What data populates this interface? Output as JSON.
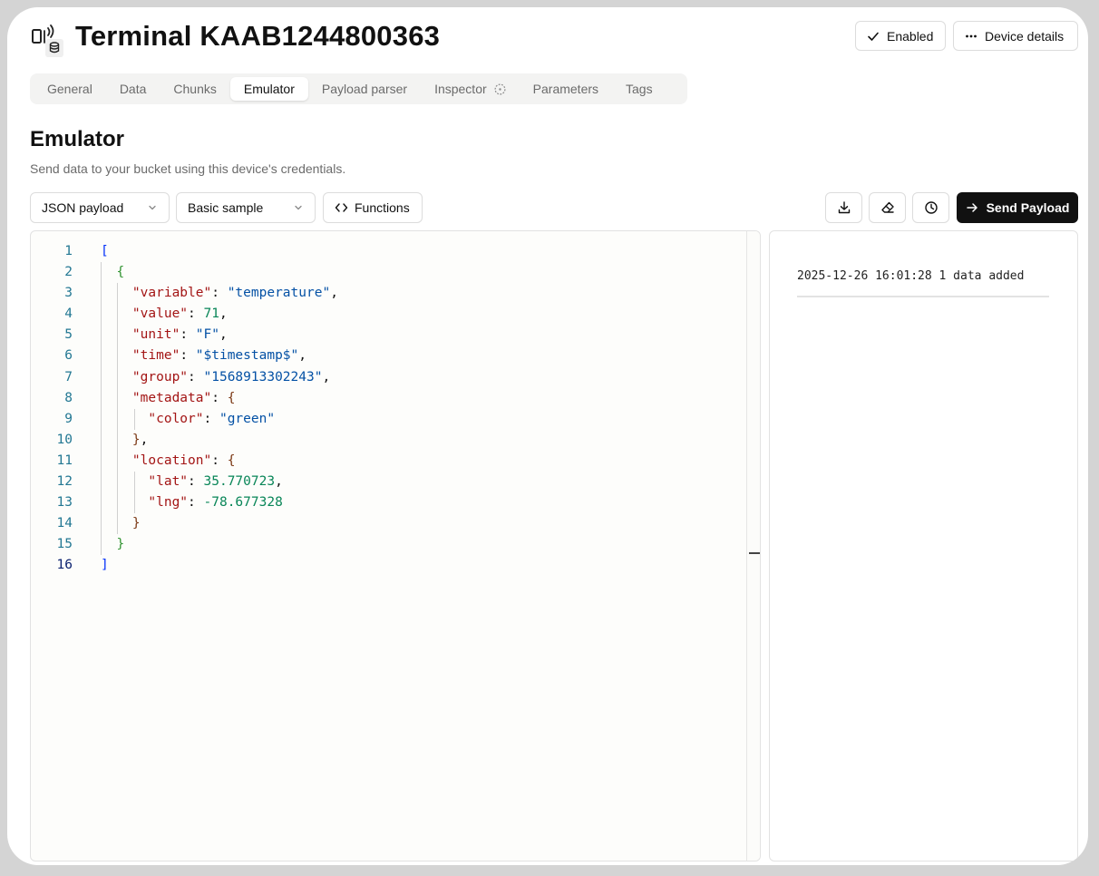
{
  "header": {
    "title": "Terminal KAAB1244800363",
    "enabled_label": "Enabled",
    "details_label": "Device details"
  },
  "tabs": [
    {
      "label": "General"
    },
    {
      "label": "Data"
    },
    {
      "label": "Chunks"
    },
    {
      "label": "Emulator",
      "active": true
    },
    {
      "label": "Payload parser"
    },
    {
      "label": "Inspector"
    },
    {
      "label": "Parameters"
    },
    {
      "label": "Tags"
    }
  ],
  "page": {
    "heading": "Emulator",
    "subtitle": "Send data to your bucket using this device's credentials."
  },
  "toolbar": {
    "format_select": "JSON payload",
    "sample_select": "Basic sample",
    "functions_label": "Functions",
    "send_label": "Send Payload",
    "icons": [
      "download-icon",
      "eraser-icon",
      "history-clock-icon"
    ]
  },
  "editor": {
    "line_numbers": [
      "1",
      "2",
      "3",
      "4",
      "5",
      "6",
      "7",
      "8",
      "9",
      "10",
      "11",
      "12",
      "13",
      "14",
      "15",
      "16"
    ],
    "current_line": "16"
  },
  "log": {
    "entries": [
      "2025-12-26 16:01:28 1 data added"
    ]
  },
  "colors": {
    "primary_button": "#111111",
    "json_key": "#a31515",
    "json_string": "#0451a5",
    "json_number": "#098658",
    "line_number": "#237893"
  }
}
